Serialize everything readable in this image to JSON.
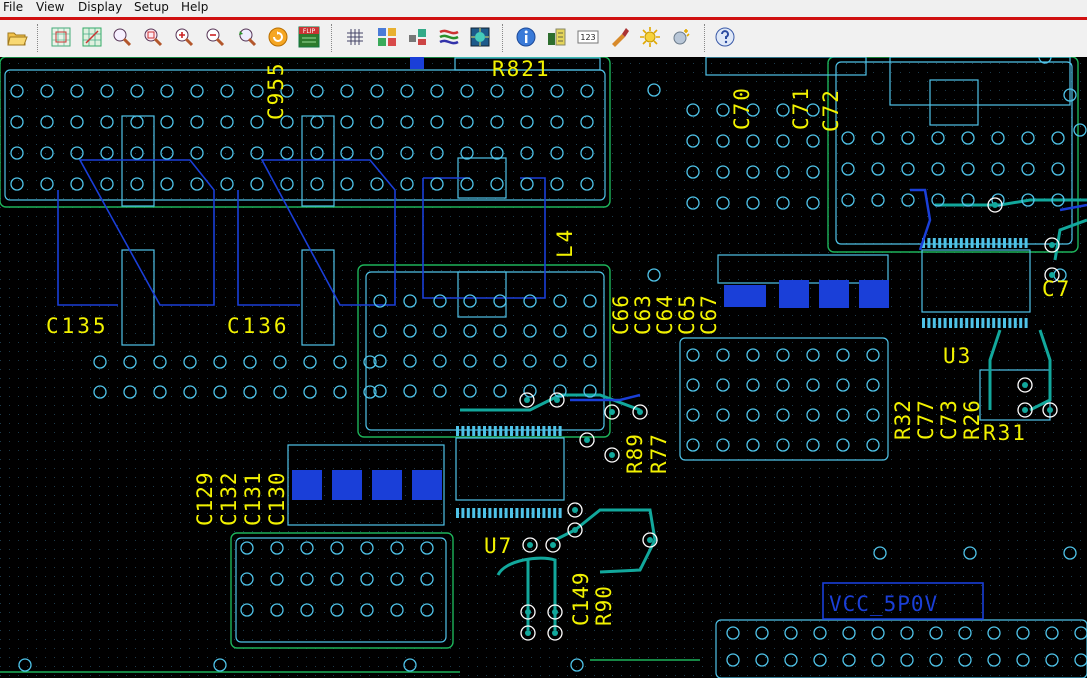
{
  "menu": {
    "file": "File",
    "view": "View",
    "display": "Display",
    "setup": "Setup",
    "help": "Help"
  },
  "toolbar": {
    "buttons": [
      {
        "icon": "open-folder-icon"
      },
      {
        "icon": "grid-zoom-fit-icon"
      },
      {
        "icon": "grid-zoom-board-icon"
      },
      {
        "icon": "zoom-area-icon"
      },
      {
        "icon": "zoom-window-icon"
      },
      {
        "icon": "zoom-in-icon"
      },
      {
        "icon": "zoom-out-icon"
      },
      {
        "icon": "zoom-previous-icon"
      },
      {
        "icon": "refresh-icon"
      },
      {
        "icon": "flip-icon",
        "text": "FLIP"
      },
      {
        "icon": "grid-icon"
      },
      {
        "icon": "layers-icon"
      },
      {
        "icon": "components-icon"
      },
      {
        "icon": "nets-icon"
      },
      {
        "icon": "board-icon"
      },
      {
        "icon": "info-icon"
      },
      {
        "icon": "query-icon"
      },
      {
        "icon": "numbers-icon",
        "text": "123"
      },
      {
        "icon": "highlight-icon"
      },
      {
        "icon": "brightness-up-icon"
      },
      {
        "icon": "brightness-down-icon"
      },
      {
        "icon": "help-icon"
      }
    ]
  },
  "labels": {
    "r821": "R821",
    "c955": "C955",
    "c70": "C70",
    "c71": "C71",
    "c72": "C72",
    "l4": "L4",
    "c135": "C135",
    "c136": "C136",
    "c66": "C66",
    "c63": "C63",
    "c64": "C64",
    "c65": "C65",
    "c67": "C67",
    "c7x": "C7",
    "u3": "U3",
    "r32": "R32",
    "c77": "C77",
    "c73": "C73",
    "r26": "R26",
    "r31": "R31",
    "r89": "R89",
    "r77": "R77",
    "c129": "C129",
    "c132": "C132",
    "c131": "C131",
    "c130": "C130",
    "u7": "U7",
    "c149": "C149",
    "r90": "R90",
    "vcc": "VCC_5P0V"
  },
  "colors": {
    "background": "#000000",
    "silkscreen": "#f2f200",
    "outline": "#4fc3e8",
    "board_outline": "#1db35a",
    "copper_bottom": "#1a3fd8",
    "copper_teal": "#12a89c",
    "menu_border": "#d01010"
  }
}
